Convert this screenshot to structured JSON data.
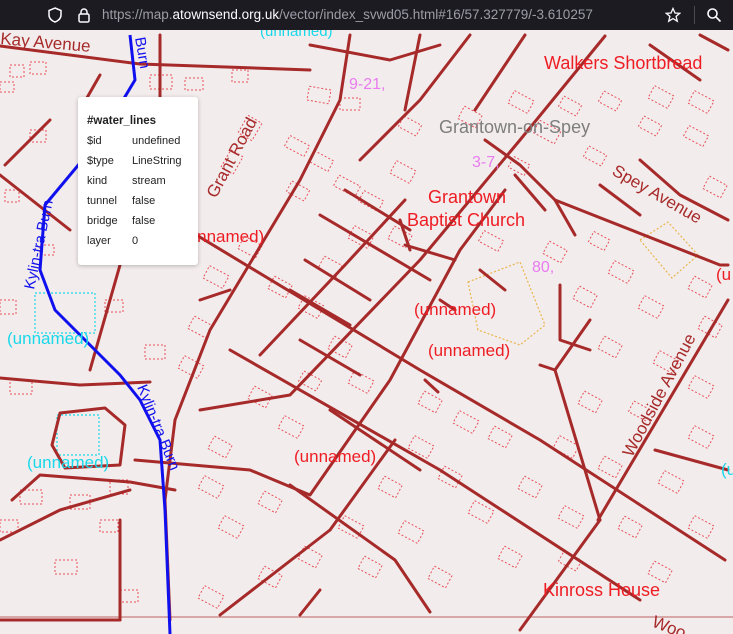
{
  "browser": {
    "url_prefix": "https://map.",
    "url_host": "atownsend.org.uk",
    "url_path": "/vector/index_svwd05.html#16/57.327779/-3.610257",
    "icons": [
      "shield-icon",
      "lock-icon",
      "star-icon",
      "search-icon"
    ]
  },
  "map": {
    "colors": {
      "background": "#f3ecec",
      "road": "#a72a2a",
      "building": "#e8505a",
      "water": "#1010ee",
      "water_label": "#19d8ea",
      "poi_label": "#ee1d24",
      "address": "#e87cf0",
      "place": "#7e7e7e"
    },
    "labels": {
      "kay_avenue": "Kay Avenue",
      "burn_top": "Burn",
      "walkers": "Walkers Shortbread",
      "num_921": "9-21,",
      "grantown_spey": "Grantown-on-Spey",
      "num_37": "3-7,",
      "grant_road": "Grant Road",
      "church_1": "Grantown",
      "church_2": "Baptist Church",
      "spey_avenue": "Spey Avenue",
      "num_80": "80,",
      "unnamed_1": "(unnamed)",
      "unnamed_2": "(unnamed)",
      "unnamed_3": "(unnamed)",
      "unnamed_4": "(unnamed)",
      "unnamed_5": "(unnamed)",
      "unnamed_6": "(unnamed)",
      "unnamed_top": "(unnamed)",
      "edge_right": "(u",
      "edge_right2": "(u",
      "kylin_1": "Kylin-tra Burn",
      "kylin_2": "Kylin-tra Burn",
      "woodside": "Woodside Avenue",
      "kinross": "Kinross House",
      "woo": "Woo"
    }
  },
  "popup": {
    "title": "#water_lines",
    "rows": [
      {
        "key": "$id",
        "value": "undefined"
      },
      {
        "key": "$type",
        "value": "LineString"
      },
      {
        "key": "kind",
        "value": "stream"
      },
      {
        "key": "tunnel",
        "value": "false"
      },
      {
        "key": "bridge",
        "value": "false"
      },
      {
        "key": "layer",
        "value": "0"
      }
    ]
  }
}
